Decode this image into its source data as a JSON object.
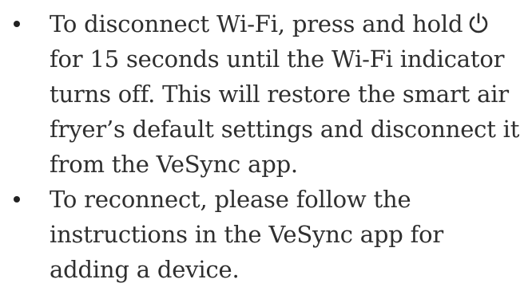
{
  "instructions": {
    "items": [
      {
        "text_before_icon": "To disconnect Wi-Fi, press and hold",
        "icon": "power-icon",
        "text_after_icon": "for 15 seconds until the Wi-Fi indicator turns off. This will restore the smart air fryer’s default settings and disconnect it from the VeSync app."
      },
      {
        "text": "To reconnect, please follow the instructions in the VeSync app for adding a device."
      }
    ]
  }
}
